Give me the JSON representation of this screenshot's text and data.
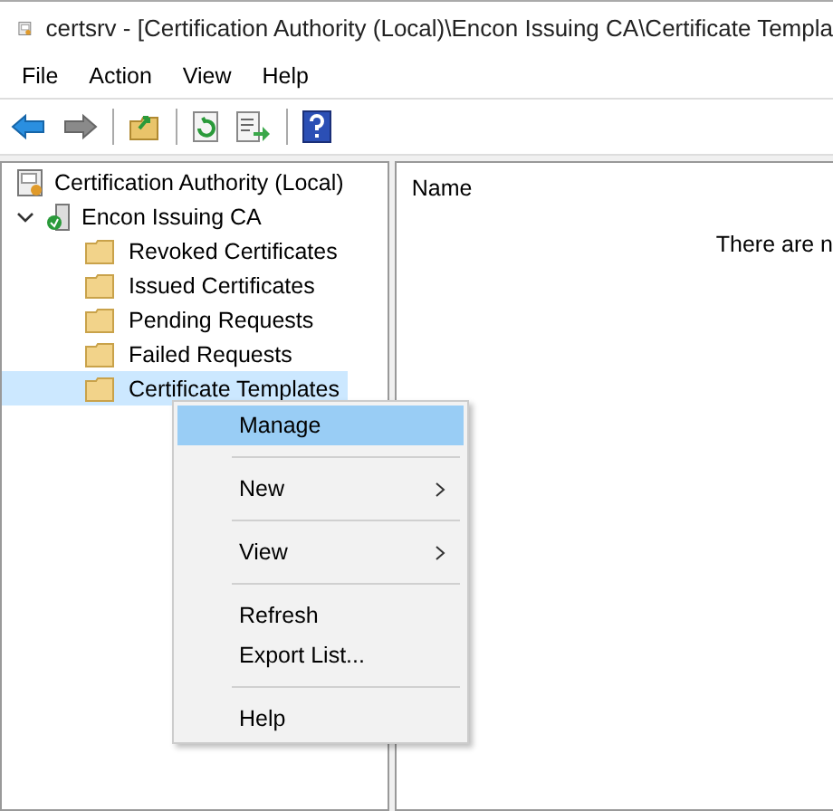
{
  "window": {
    "title": "certsrv - [Certification Authority (Local)\\Encon Issuing CA\\Certificate Templa"
  },
  "menu_bar": [
    "File",
    "Action",
    "View",
    "Help"
  ],
  "toolbar": [
    {
      "kind": "back"
    },
    {
      "kind": "forward"
    },
    {
      "kind": "separator"
    },
    {
      "kind": "up"
    },
    {
      "kind": "separator"
    },
    {
      "kind": "refresh"
    },
    {
      "kind": "export"
    },
    {
      "kind": "separator"
    },
    {
      "kind": "help"
    }
  ],
  "tree": {
    "label": "Certification Authority (Local)",
    "selected": false,
    "children": [
      {
        "label": "Encon Issuing CA",
        "expanded": true,
        "selected": false,
        "children": [
          {
            "label": "Revoked Certificates",
            "selected": false
          },
          {
            "label": "Issued Certificates",
            "selected": false
          },
          {
            "label": "Pending Requests",
            "selected": false
          },
          {
            "label": "Failed Requests",
            "selected": false
          },
          {
            "label": "Certificate Templates",
            "selected": true
          }
        ]
      }
    ]
  },
  "list": {
    "column_header": "Name",
    "empty_text": "There are n"
  },
  "context_menu": [
    {
      "kind": "item",
      "label": "Manage",
      "selected": true,
      "submenu": false
    },
    {
      "kind": "separator"
    },
    {
      "kind": "item",
      "label": "New",
      "selected": false,
      "submenu": true
    },
    {
      "kind": "separator"
    },
    {
      "kind": "item",
      "label": "View",
      "selected": false,
      "submenu": true
    },
    {
      "kind": "separator"
    },
    {
      "kind": "item",
      "label": "Refresh",
      "selected": false,
      "submenu": false
    },
    {
      "kind": "item",
      "label": "Export List...",
      "selected": false,
      "submenu": false
    },
    {
      "kind": "separator"
    },
    {
      "kind": "item",
      "label": "Help",
      "selected": false,
      "submenu": false
    }
  ]
}
